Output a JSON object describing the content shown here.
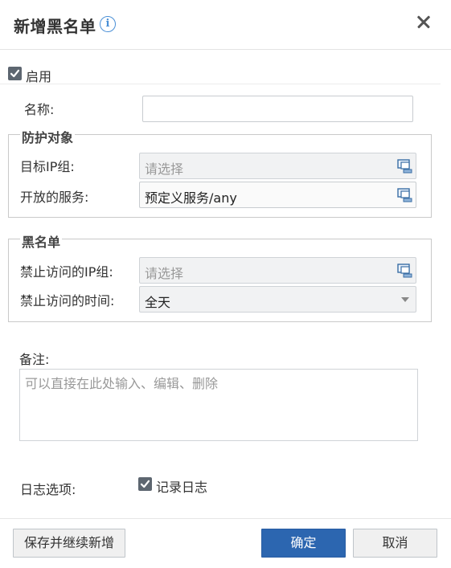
{
  "dialog": {
    "title": "新增黑名单",
    "info_icon": "i",
    "close_icon": "close-icon"
  },
  "enable": {
    "label": "启用",
    "checked": true
  },
  "name_field": {
    "label": "名称:",
    "value": ""
  },
  "protected_object": {
    "legend": "防护对象",
    "target_ip_group": {
      "label": "目标IP组:",
      "placeholder": "请选择"
    },
    "open_service": {
      "label": "开放的服务:",
      "value": "预定义服务/any"
    }
  },
  "blacklist": {
    "legend": "黑名单",
    "blocked_ip_group": {
      "label": "禁止访问的IP组:",
      "placeholder": "请选择"
    },
    "blocked_time": {
      "label": "禁止访问的时间:",
      "value": "全天"
    }
  },
  "remarks": {
    "label": "备注:",
    "placeholder": "可以直接在此处输入、编辑、删除"
  },
  "log_options": {
    "label": "日志选项:",
    "record_log_label": "记录日志",
    "record_log_checked": true
  },
  "buttons": {
    "save_and_continue": "保存并继续新增",
    "confirm": "确定",
    "cancel": "取消"
  },
  "colors": {
    "primary": "#2c66b0",
    "checkbox": "#5d6670",
    "info": "#4a8fd6"
  }
}
